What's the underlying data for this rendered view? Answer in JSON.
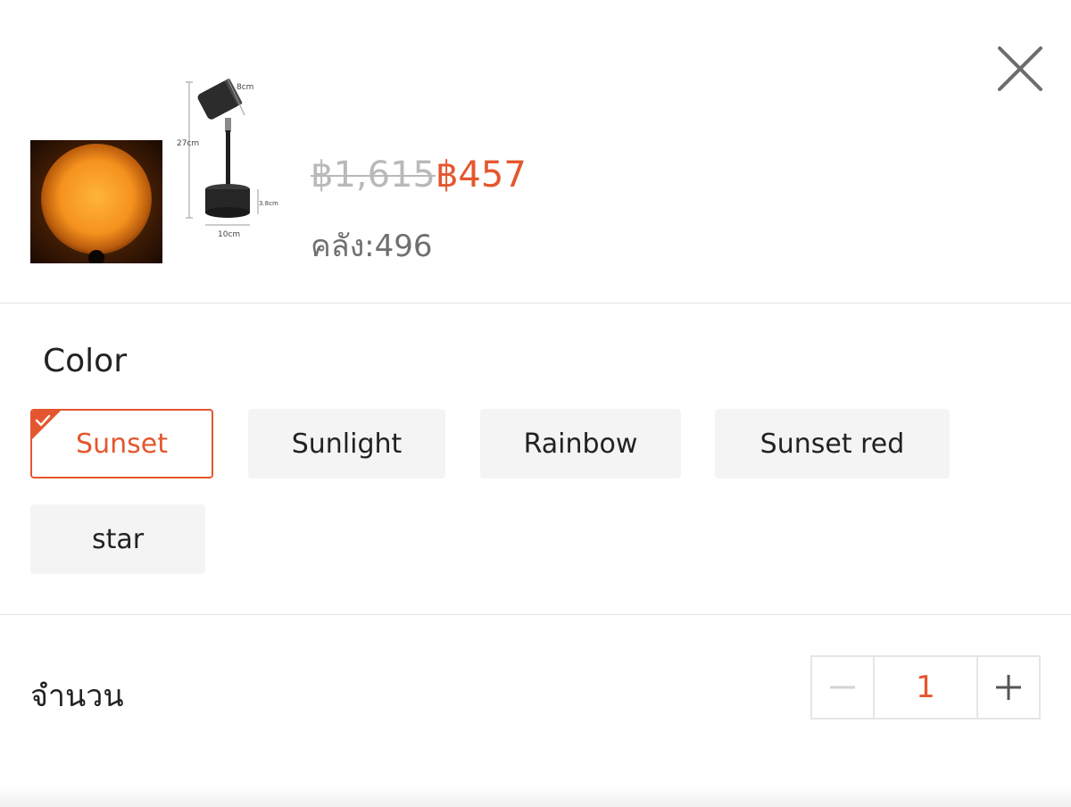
{
  "header": {
    "close_icon": "close-icon"
  },
  "product": {
    "main_image": "sunset-lamp-glow",
    "dimension_image": "lamp-dimensions",
    "dimensions": {
      "head": "8cm",
      "height": "27cm",
      "base_height": "3.8cm",
      "base_width": "10cm"
    },
    "price_original": "฿1,615",
    "price_current": "฿457",
    "stock_label": "คลัง:496"
  },
  "variants": {
    "title": "Color",
    "options": [
      "Sunset",
      "Sunlight",
      "Rainbow",
      "Sunset red",
      "star"
    ],
    "selected": "Sunset"
  },
  "quantity": {
    "label": "จำนวน",
    "value": "1",
    "minus_icon": "minus-icon",
    "plus_icon": "plus-icon"
  },
  "colors": {
    "accent": "#e4572e",
    "muted": "#b9b9b9",
    "chip_bg": "#f4f4f4"
  }
}
